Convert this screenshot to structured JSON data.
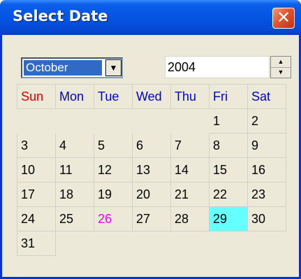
{
  "window": {
    "title": "Select Date",
    "close_label": "✕"
  },
  "controls": {
    "month": "October",
    "month_arrow": "▼",
    "year": "2004",
    "spin_up": "▲",
    "spin_down": "▼"
  },
  "weekdays": [
    "Sun",
    "Mon",
    "Tue",
    "Wed",
    "Thu",
    "Fri",
    "Sat"
  ],
  "weeks": [
    [
      "",
      "",
      "",
      "",
      "",
      "1",
      "2"
    ],
    [
      "3",
      "4",
      "5",
      "6",
      "7",
      "8",
      "9"
    ],
    [
      "10",
      "11",
      "12",
      "13",
      "14",
      "15",
      "16"
    ],
    [
      "17",
      "18",
      "19",
      "20",
      "21",
      "22",
      "23"
    ],
    [
      "24",
      "25",
      "26",
      "27",
      "28",
      "29",
      "30"
    ],
    [
      "31",
      "",
      "",
      "",
      "",
      "",
      ""
    ]
  ],
  "today_day": "26",
  "selected_day": "29",
  "colors": {
    "title_bar": "#0554E3",
    "weekday": "#0000CC",
    "sunday": "#E00000",
    "today": "#FF00FF",
    "selected_bg": "#66FFFF"
  }
}
